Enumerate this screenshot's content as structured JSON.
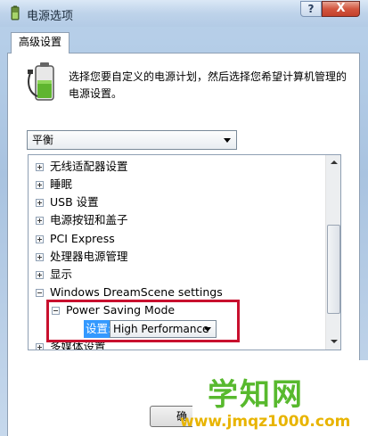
{
  "window": {
    "title": "电源选项",
    "help_label": "?",
    "close_label": "X"
  },
  "tabs": [
    {
      "label": "高级设置"
    }
  ],
  "description": "选择您要自定义的电源计划，然后选择您希望计算机管理的电源设置。",
  "plan_select": {
    "value": "平衡"
  },
  "tree": {
    "items": [
      {
        "label": "无线适配器设置",
        "expanded": false
      },
      {
        "label": "睡眠",
        "expanded": false
      },
      {
        "label": "USB 设置",
        "expanded": false
      },
      {
        "label": "电源按钮和盖子",
        "expanded": false
      },
      {
        "label": "PCI Express",
        "expanded": false
      },
      {
        "label": "处理器电源管理",
        "expanded": false
      },
      {
        "label": "显示",
        "expanded": false
      },
      {
        "label": "Windows DreamScene settings",
        "expanded": true
      }
    ],
    "child": {
      "label": "Power Saving Mode",
      "setting_label": "设置:",
      "setting_value": "High Performance"
    },
    "partial_item": "多媒体设置"
  },
  "buttons": {
    "ok_partial": "确"
  },
  "watermark": {
    "main": "学知网",
    "url": "www.jmqz1000.com"
  },
  "colors": {
    "highlight_box": "#c8102e",
    "selection": "#3399ff",
    "watermark_green": "#58b92e",
    "watermark_yellow": "#e8b400"
  }
}
